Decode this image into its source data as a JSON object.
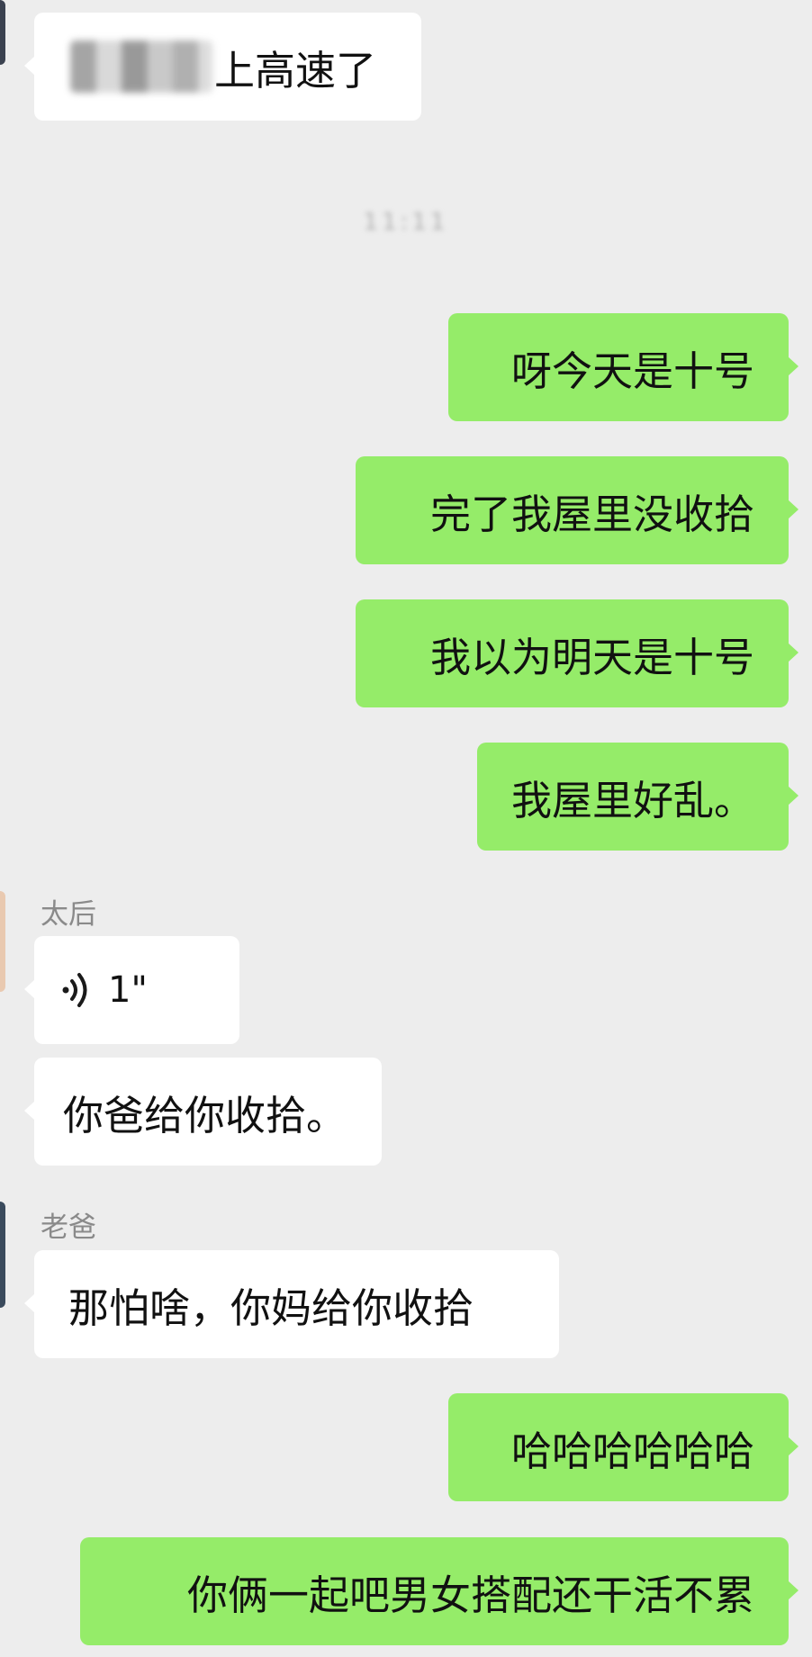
{
  "chat": {
    "time_label": "11:11",
    "messages": {
      "m0": {
        "text": "上高速了",
        "redacted_prefix": "blurred-name"
      },
      "m1": {
        "text": "呀今天是十号"
      },
      "m2": {
        "text": "完了我屋里没收拾"
      },
      "m3": {
        "text": "我以为明天是十号"
      },
      "m4": {
        "text": "我屋里好乱。"
      },
      "m5": {
        "sender": "太后",
        "voice_duration": "1\"",
        "icon": "voice-wave-icon"
      },
      "m6": {
        "text": "你爸给你收拾。"
      },
      "m7": {
        "sender": "老爸",
        "text": "那怕啥，你妈给你收拾"
      },
      "m8": {
        "text": "哈哈哈哈哈哈"
      },
      "m9": {
        "text": "你俩一起吧男女搭配还干活不累"
      }
    }
  },
  "colors": {
    "background": "#ededed",
    "incoming_bubble": "#ffffff",
    "outgoing_bubble": "#95ec69",
    "text": "#111111",
    "sender_name": "#8a8a8a"
  }
}
